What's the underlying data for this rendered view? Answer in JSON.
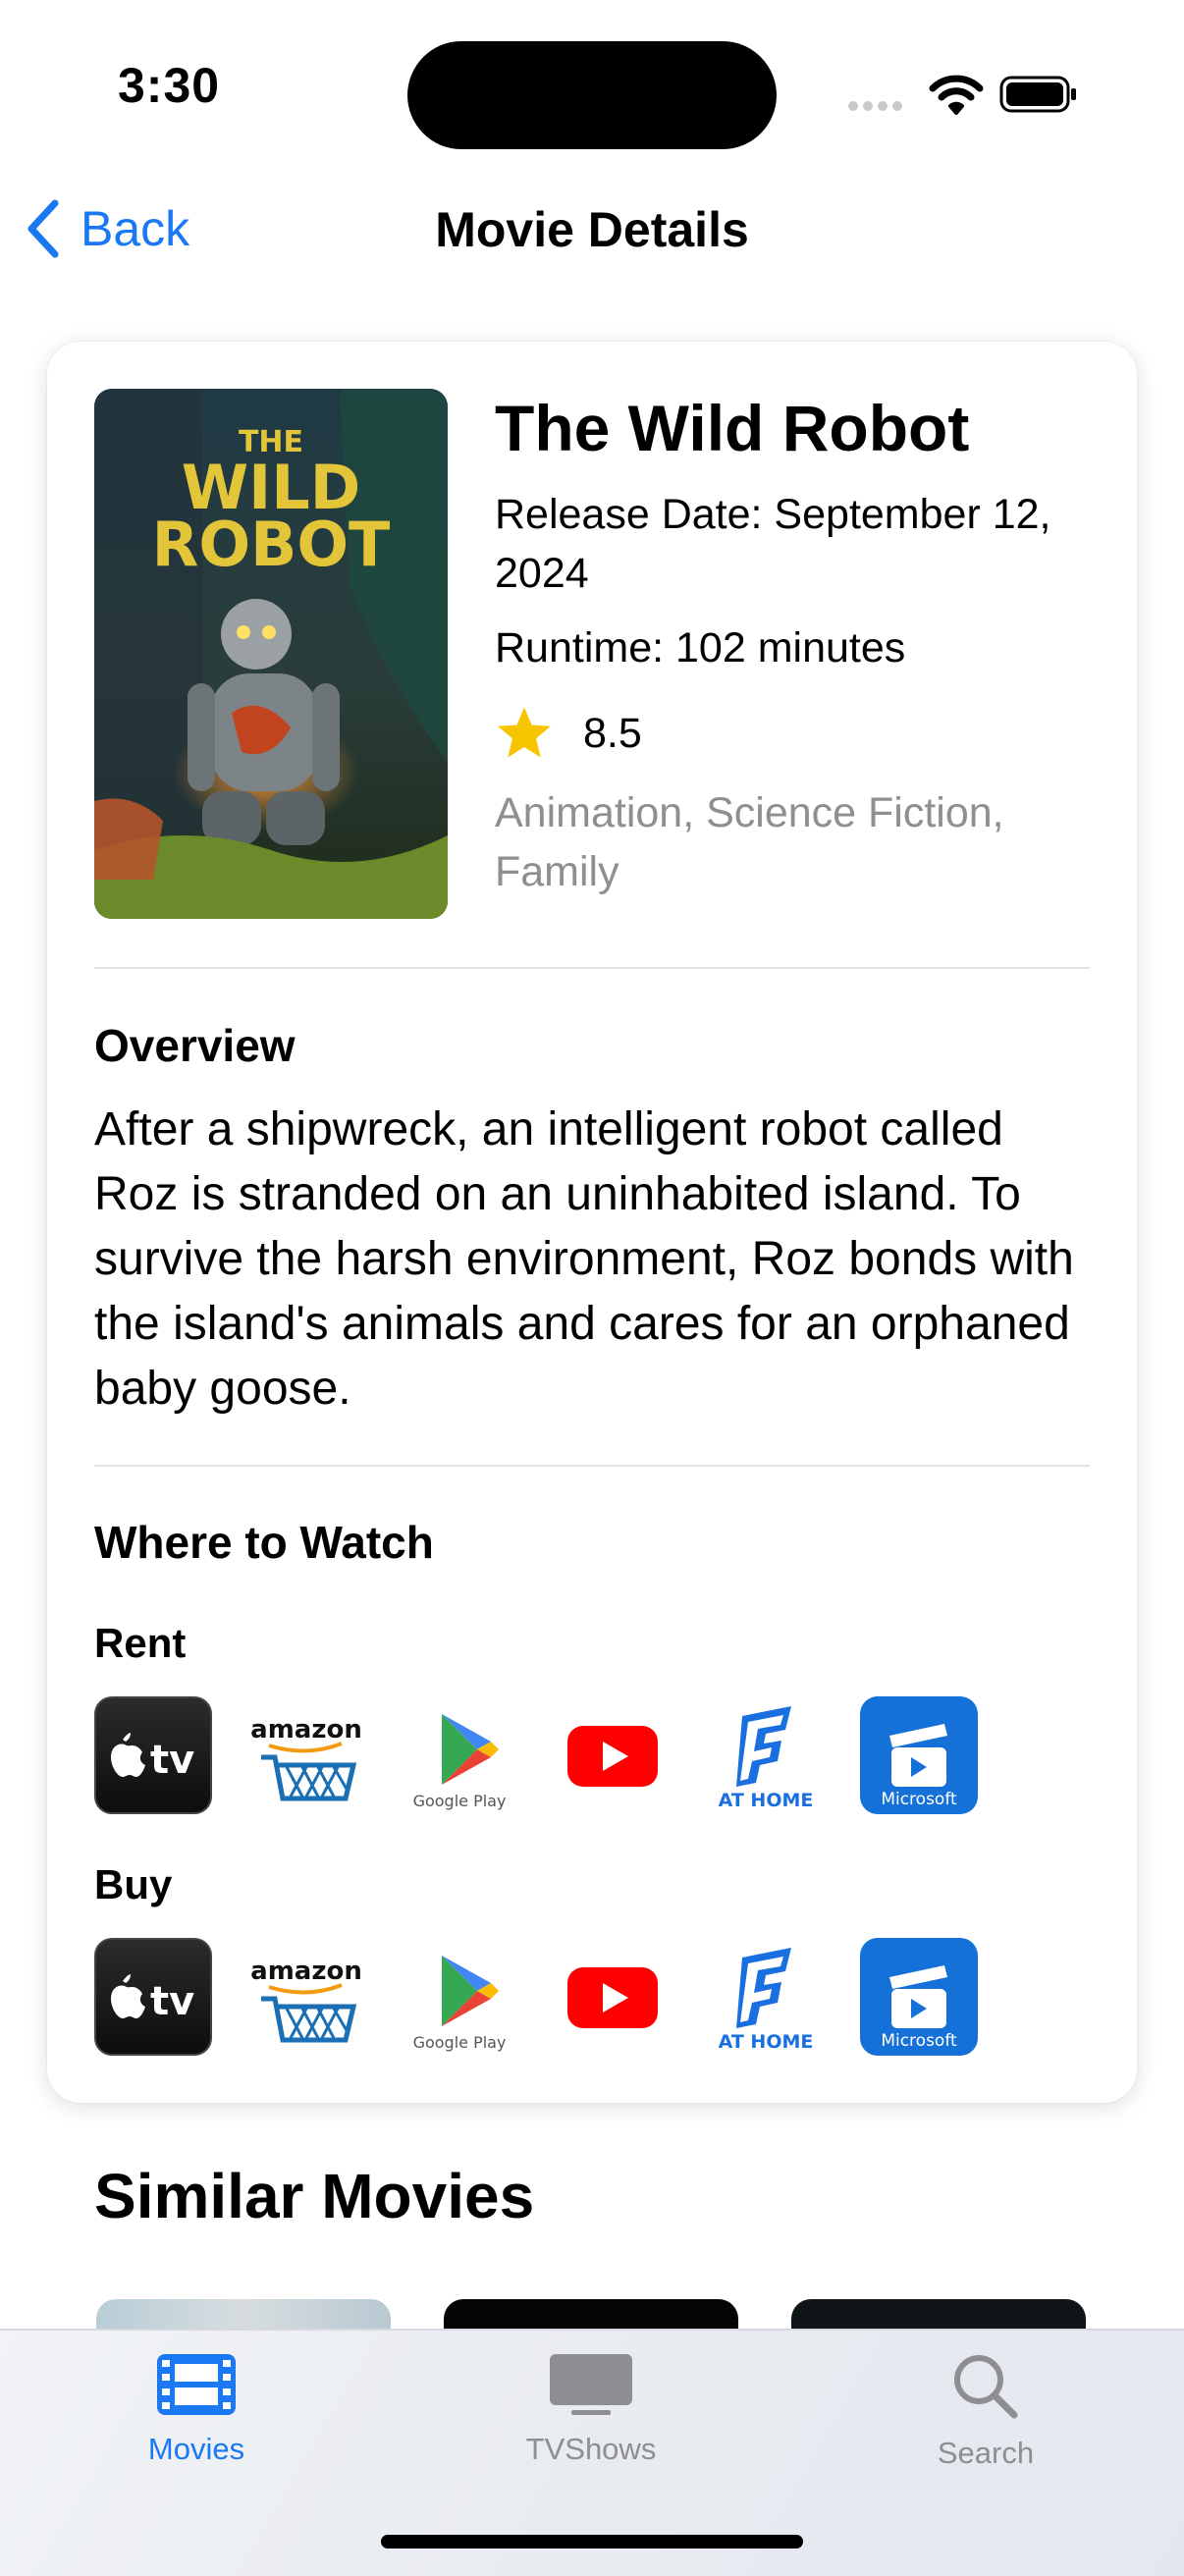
{
  "status_bar": {
    "time": "3:30"
  },
  "nav": {
    "back_label": "Back",
    "title": "Movie Details"
  },
  "movie": {
    "poster_text_line1": "THE",
    "poster_text_line2": "WILD",
    "poster_text_line3": "ROBOT",
    "title": "The Wild Robot",
    "release": "Release Date: September 12, 2024",
    "runtime": "Runtime: 102 minutes",
    "rating": "8.5",
    "genres": "Animation, Science Fiction, Family"
  },
  "overview": {
    "heading": "Overview",
    "text": "After a shipwreck, an intelligent robot called Roz is stranded on an uninhabited island. To survive the harsh environment, Roz bonds with the island's animals and cares for an orphaned baby goose."
  },
  "where_to_watch": {
    "heading": "Where to Watch",
    "rent_label": "Rent",
    "buy_label": "Buy",
    "providers": [
      {
        "name": "Apple TV",
        "icon": "apple-tv-icon",
        "text": "tv"
      },
      {
        "name": "Amazon",
        "icon": "amazon-icon",
        "text": "amazon"
      },
      {
        "name": "Google Play",
        "icon": "google-play-icon",
        "text": "Google Play"
      },
      {
        "name": "YouTube",
        "icon": "youtube-icon"
      },
      {
        "name": "Fandango At Home",
        "icon": "fandango-icon",
        "text": "AT HOME"
      },
      {
        "name": "Microsoft",
        "icon": "microsoft-store-icon",
        "text": "Microsoft"
      }
    ]
  },
  "similar": {
    "heading": "Similar Movies"
  },
  "tabbar": {
    "items": [
      {
        "label": "Movies",
        "icon": "film-icon",
        "active": true
      },
      {
        "label": "TVShows",
        "icon": "tv-icon",
        "active": false
      },
      {
        "label": "Search",
        "icon": "search-icon",
        "active": false
      }
    ]
  },
  "colors": {
    "accent": "#1a78f2",
    "star": "#f7c400",
    "secondary_text": "#8e8e93",
    "inactive_tab": "#8e8e93"
  }
}
